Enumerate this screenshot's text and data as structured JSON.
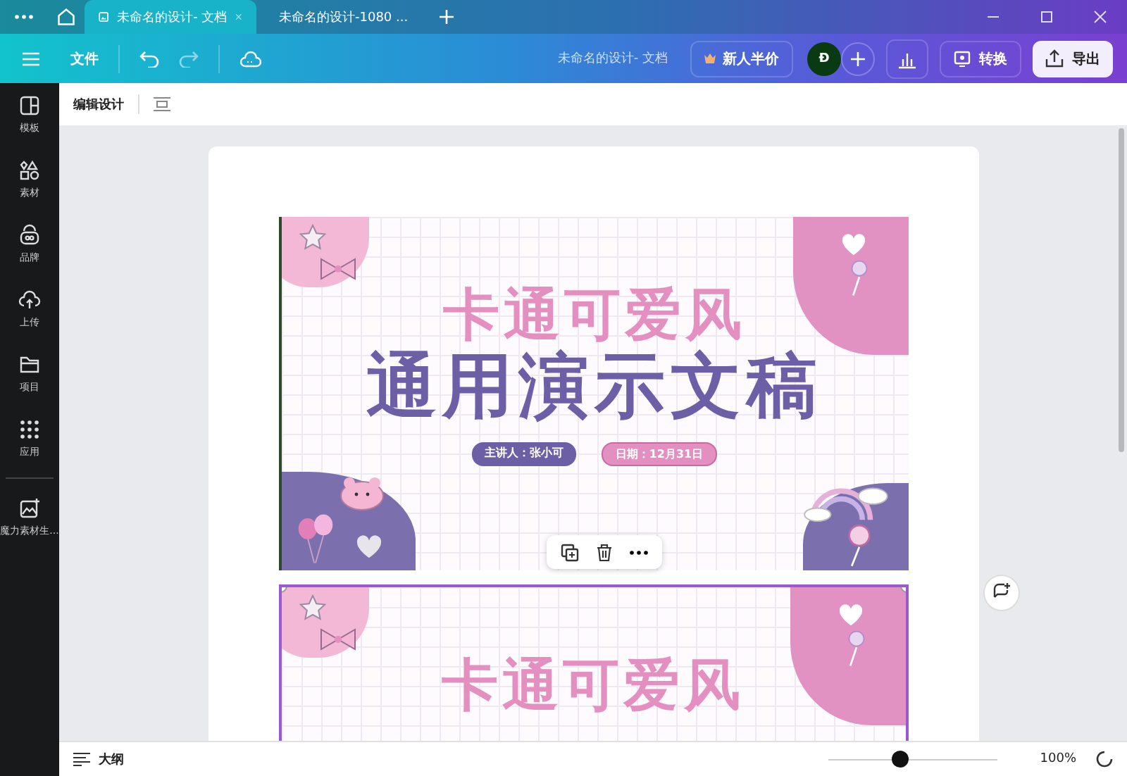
{
  "tabs": [
    {
      "label": "未命名的设计- 文档",
      "kind": "doc",
      "selected": true
    },
    {
      "label": "未命名的设计-1080 ...",
      "kind": "canva",
      "selected": false
    }
  ],
  "toolbar": {
    "file_menu": "文件",
    "doc_title": "未命名的设计- 文档",
    "promo": "新人半价",
    "avatar": "Đ",
    "convert": "转换",
    "export": "导出"
  },
  "sidebar": {
    "items": [
      {
        "label": "模板",
        "kind": "template"
      },
      {
        "label": "素材",
        "kind": "elements"
      },
      {
        "label": "品牌",
        "kind": "brand"
      },
      {
        "label": "上传",
        "kind": "upload"
      },
      {
        "label": "项目",
        "kind": "folder"
      },
      {
        "label": "应用",
        "kind": "apps"
      },
      {
        "label": "魔力素材生...",
        "kind": "magic"
      }
    ]
  },
  "edit_bar": {
    "label": "编辑设计"
  },
  "slides": [
    {
      "title_1": "卡通可爱风",
      "title_2": "通用演示文稿",
      "presenter": "主讲人：张小可",
      "date": "日期：12月31日",
      "selected": false
    },
    {
      "title_1": "卡通可爱风",
      "selected": true
    }
  ],
  "status_bar": {
    "outline": "大纲",
    "zoom": {
      "level": 0.42
    },
    "zoom_text": "100%"
  }
}
